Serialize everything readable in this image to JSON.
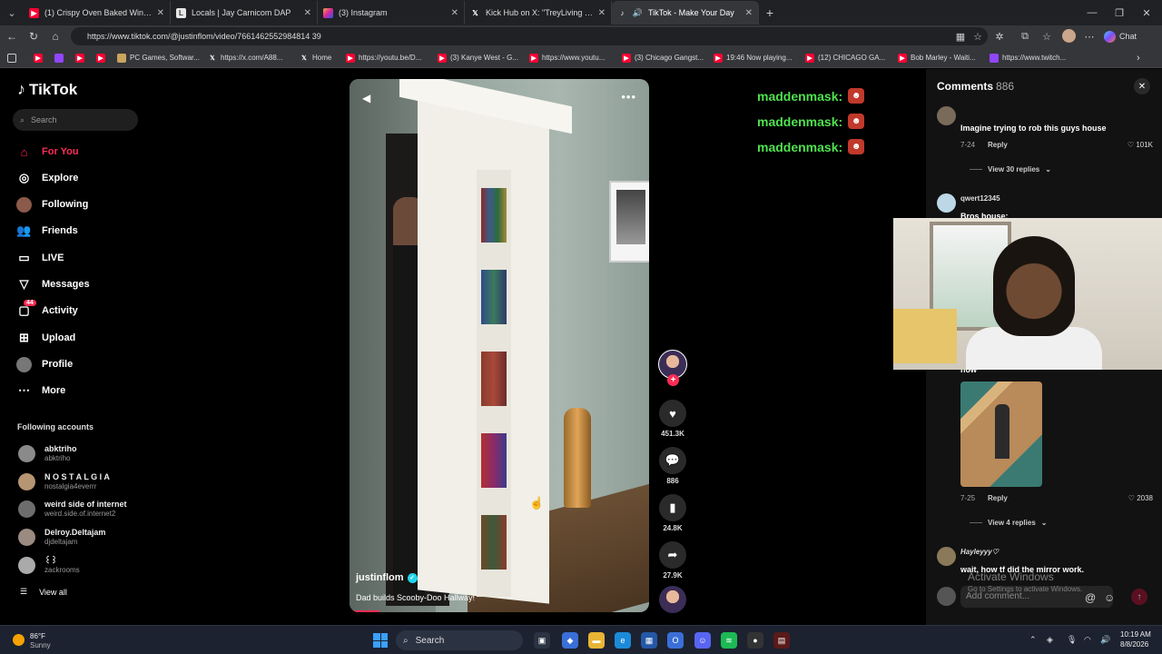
{
  "browser": {
    "tabs": [
      {
        "title": "(1) Crispy Oven Baked Wings | #g",
        "icon": "youtube-icon",
        "active": false
      },
      {
        "title": "Locals | Jay Carnicom DAP",
        "icon": "locals-icon",
        "active": false
      },
      {
        "title": "(3) Instagram",
        "icon": "instagram-icon",
        "active": false
      },
      {
        "title": "Kick Hub on X: \"TreyLiving slaps U",
        "icon": "x-icon",
        "active": false
      },
      {
        "title": "TikTok - Make Your Day",
        "icon": "tiktok-icon",
        "active": true
      }
    ],
    "url": "https://www.tiktok.com/@justinflom/video/7661462552984814 39",
    "chat_label": "Chat",
    "bookmarks": [
      {
        "label": "",
        "icon": "youtube"
      },
      {
        "label": "",
        "icon": "twitch"
      },
      {
        "label": "",
        "icon": "youtube"
      },
      {
        "label": "",
        "icon": "youtube"
      },
      {
        "label": "PC Games, Softwar...",
        "icon": "game"
      },
      {
        "label": "https://x.com/A88...",
        "icon": "x"
      },
      {
        "label": "Home",
        "icon": "x"
      },
      {
        "label": "https://youtu.be/D...",
        "icon": "youtube"
      },
      {
        "label": "(3) Kanye West - G...",
        "icon": "youtube"
      },
      {
        "label": "https://www.youtu...",
        "icon": "youtube"
      },
      {
        "label": "(3) Chicago Gangst...",
        "icon": "youtube"
      },
      {
        "label": "19:46 Now playing...",
        "icon": "youtube"
      },
      {
        "label": "(12) CHICAGO GA...",
        "icon": "youtube"
      },
      {
        "label": "Bob Marley - Waiti...",
        "icon": "youtube"
      },
      {
        "label": "https://www.twitch...",
        "icon": "twitch"
      }
    ]
  },
  "tiktok": {
    "logo": "TikTok",
    "search_placeholder": "Search",
    "nav": [
      {
        "label": "For You",
        "icon": "home-icon",
        "active": true
      },
      {
        "label": "Explore",
        "icon": "compass-icon"
      },
      {
        "label": "Following",
        "icon": "following-avatar-icon"
      },
      {
        "label": "Friends",
        "icon": "friends-icon"
      },
      {
        "label": "LIVE",
        "icon": "live-icon"
      },
      {
        "label": "Messages",
        "icon": "messages-icon"
      },
      {
        "label": "Activity",
        "icon": "activity-icon",
        "badge": "44"
      },
      {
        "label": "Upload",
        "icon": "upload-icon"
      },
      {
        "label": "Profile",
        "icon": "profile-avatar-icon"
      },
      {
        "label": "More",
        "icon": "more-icon"
      }
    ],
    "following_title": "Following accounts",
    "following_accounts": [
      {
        "name": "abktriho",
        "handle": "abktriho"
      },
      {
        "name": "N O S T A L G I A",
        "handle": "nostalgia4everrr"
      },
      {
        "name": "weird side of internet",
        "handle": "weird.side.of.internet2"
      },
      {
        "name": "Delroy.Deltajam",
        "handle": "djdeltajam"
      },
      {
        "name": "꒰꒱",
        "handle": "zackrooms"
      }
    ],
    "view_all": "View all",
    "video": {
      "author": "justinflom",
      "caption": "Dad builds Scooby-Doo Hallway!",
      "progress_percent": 10
    },
    "actions": {
      "likes": "451.3K",
      "comments": "886",
      "saves": "24.8K",
      "shares": "27.9K"
    },
    "overlay_chat": [
      "maddenmask:",
      "maddenmask:",
      "maddenmask:"
    ],
    "comments_panel": {
      "title": "Comments",
      "count": "886",
      "items": [
        {
          "user": "",
          "text": "Imagine trying to rob this guys house",
          "date": "7-24",
          "reply": "Reply",
          "likes": "101K",
          "view_replies": "View 30 replies"
        },
        {
          "user": "qwert12345",
          "text": "Bros house:",
          "date": "",
          "reply": "",
          "likes": ""
        },
        {
          "user": "",
          "text": "now",
          "date": "7-25",
          "reply": "Reply",
          "likes": "2038",
          "view_replies": "View 4 replies"
        },
        {
          "user": "Hayleyyy♡",
          "text": "wait, how tf did the mirror work.",
          "date": "",
          "reply": "",
          "likes": ""
        }
      ],
      "add_placeholder": "Add comment..."
    }
  },
  "windows_watermark": {
    "line1": "Activate Windows",
    "line2": "Go to Settings to activate Windows."
  },
  "taskbar": {
    "temp": "86°F",
    "weather": "Sunny",
    "search": "Search",
    "time": "10:19 AM",
    "date": "8/8/2026"
  }
}
